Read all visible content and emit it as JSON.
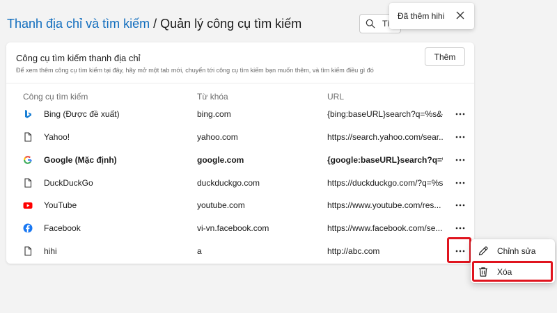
{
  "breadcrumb": {
    "parent": "Thanh địa chỉ và tìm kiếm",
    "separator": "/",
    "current": "Quản lý công cụ tìm kiếm"
  },
  "search": {
    "value": "Tì",
    "placeholder": "Tìm kiếm"
  },
  "toast": {
    "message": "Đã thêm hihi"
  },
  "card": {
    "title": "Công cụ tìm kiếm thanh địa chỉ",
    "description": "Để xem thêm công cụ tìm kiếm tại đây, hãy mở một tab mới, chuyển tới công cụ tìm kiếm bạn muốn thêm, và tìm kiếm điều gì đó",
    "add_label": "Thêm"
  },
  "table": {
    "headers": {
      "name": "Công cụ tìm kiếm",
      "keyword": "Từ khóa",
      "url": "URL"
    },
    "rows": [
      {
        "name": "Bing (Được đề xuất)",
        "keyword": "bing.com",
        "url": "{bing:baseURL}search?q=%s&{...",
        "icon": "bing-icon"
      },
      {
        "name": "Yahoo!",
        "keyword": "yahoo.com",
        "url": "https://search.yahoo.com/sear...",
        "icon": "page-icon"
      },
      {
        "name": "Google (Mặc định)",
        "keyword": "google.com",
        "url": "{google:baseURL}search?q=%...",
        "icon": "google-icon"
      },
      {
        "name": "DuckDuckGo",
        "keyword": "duckduckgo.com",
        "url": "https://duckduckgo.com/?q=%s",
        "icon": "page-icon"
      },
      {
        "name": "YouTube",
        "keyword": "youtube.com",
        "url": "https://www.youtube.com/res...",
        "icon": "youtube-icon"
      },
      {
        "name": "Facebook",
        "keyword": "vi-vn.facebook.com",
        "url": "https://www.facebook.com/se...",
        "icon": "facebook-icon"
      },
      {
        "name": "hihi",
        "keyword": "a",
        "url": "http://abc.com",
        "icon": "page-icon"
      }
    ]
  },
  "context_menu": {
    "edit_label": "Chỉnh sửa",
    "delete_label": "Xóa"
  },
  "colors": {
    "accent": "#0f6cbd",
    "highlight": "#e0141e",
    "bing": "#1a7fd4",
    "youtube": "#ff0000",
    "facebook": "#1877f2"
  }
}
